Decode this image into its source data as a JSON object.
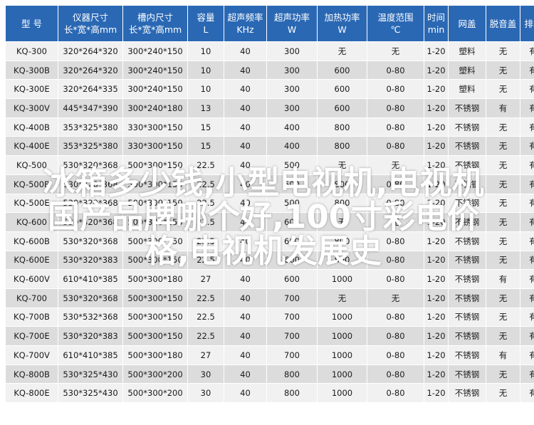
{
  "header": {
    "model": [
      "型 号"
    ],
    "outer_size": [
      "仪器尺寸",
      "长*宽*高mm"
    ],
    "inner_size": [
      "槽内尺寸",
      "长*宽*高mm"
    ],
    "capacity": [
      "容量",
      "L"
    ],
    "sonic_freq": [
      "超声频率",
      "KHz"
    ],
    "sonic_power": [
      "超声功率",
      "W"
    ],
    "heat_power": [
      "加热功率",
      "W"
    ],
    "temp_range": [
      "温度范围",
      "℃"
    ],
    "time": [
      "时间",
      "min"
    ],
    "cover": [
      "网盖"
    ],
    "degas": [
      "脱音盖"
    ],
    "drain": [
      "排水"
    ]
  },
  "rows": [
    [
      "KQ-300",
      "320*264*320",
      "300*240*150",
      "10",
      "40",
      "300",
      "无",
      "无",
      "1-20",
      "塑料",
      "无",
      "有"
    ],
    [
      "KQ-300B",
      "320*264*320",
      "300*240*150",
      "10",
      "40",
      "300",
      "600",
      "0-80",
      "1-20",
      "塑料",
      "无",
      "有"
    ],
    [
      "KQ-300E",
      "320*264*335",
      "300*240*150",
      "10",
      "40",
      "300",
      "600",
      "0-80",
      "1-20",
      "塑料",
      "无",
      "有"
    ],
    [
      "KQ-300V",
      "445*347*390",
      "300*240*180",
      "13",
      "40",
      "300",
      "600",
      "0-80",
      "1-20",
      "不锈钢",
      "有",
      "有"
    ],
    [
      "KQ-400B",
      "353*325*380",
      "330*300*150",
      "15",
      "40",
      "400",
      "800",
      "0-80",
      "1-20",
      "不锈钢",
      "无",
      "有"
    ],
    [
      "KQ-400E",
      "353*325*380",
      "330*300*150",
      "15",
      "40",
      "400",
      "800",
      "0-80",
      "1-20",
      "不锈钢",
      "无",
      "有"
    ],
    [
      "KQ-500",
      "530*320*368",
      "500*300*150",
      "22.5",
      "40",
      "500",
      "无",
      "无",
      "1-20",
      "不锈钢",
      "无",
      "有"
    ],
    [
      "KQ-500B",
      "530*320*368",
      "500*300*150",
      "22.5",
      "40",
      "500",
      "800",
      "0-80",
      "1-20",
      "不锈钢",
      "无",
      "有"
    ],
    [
      "KQ-500E",
      "530*320*368",
      "500*300*150",
      "22.5",
      "40",
      "500",
      "800",
      "0-80",
      "1-20",
      "不锈钢",
      "无",
      "有"
    ],
    [
      "KQ-600",
      "530*320*368",
      "500*300*150",
      "22.5",
      "40",
      "600",
      "无",
      "无",
      "1-20",
      "不锈钢",
      "无",
      "有"
    ],
    [
      "KQ-600B",
      "530*320*368",
      "500*300*150",
      "22.5",
      "40",
      "600",
      "800",
      "0-80",
      "1-20",
      "不锈钢",
      "无",
      "有"
    ],
    [
      "KQ-600E",
      "530*320*383",
      "500*300*150",
      "22.5",
      "40",
      "600",
      "800",
      "0-80",
      "1-20",
      "不锈钢",
      "无",
      "有"
    ],
    [
      "KQ-600V",
      "610*410*385",
      "500*300*180",
      "27",
      "40",
      "600",
      "1000",
      "0-80",
      "1-20",
      "不锈钢",
      "有",
      "有"
    ],
    [
      "KQ-700",
      "530*320*368",
      "500*300*150",
      "22.5",
      "40",
      "700",
      "无",
      "无",
      "1-20",
      "不锈钢",
      "无",
      "有"
    ],
    [
      "KQ-700B",
      "530*532*368",
      "500*300*150",
      "22.5",
      "40",
      "700",
      "1000",
      "0-80",
      "1-20",
      "不锈钢",
      "无",
      "有"
    ],
    [
      "KQ-700E",
      "530*320*383",
      "500*300*150",
      "22.5",
      "40",
      "700",
      "1000",
      "0-80",
      "1-20",
      "不锈钢",
      "无",
      "有"
    ],
    [
      "KQ-700V",
      "610*410*385",
      "500*300*180",
      "27",
      "40",
      "700",
      "1000",
      "0-80",
      "1-20",
      "不锈钢",
      "有",
      "有"
    ],
    [
      "KQ-800B",
      "530*325*430",
      "500*300*200",
      "30",
      "40",
      "800",
      "1000",
      "0-80",
      "1-20",
      "不锈钢",
      "无",
      "有"
    ],
    [
      "KQ-800E",
      "530*325*430",
      "500*300*200",
      "30",
      "40",
      "800",
      "1000",
      "0-80",
      "1-20",
      "不锈钢",
      "无",
      "有"
    ]
  ],
  "watermark": {
    "lines": [
      "冰箱多少钱,小型电视机,电视机",
      "国产品牌哪个好,100寸彩电价",
      "格,电视机发展史"
    ]
  },
  "colors": {
    "header_bg": "#2a68b4",
    "row_light": "#f1f1f1",
    "row_dark": "#dcdcdc"
  }
}
